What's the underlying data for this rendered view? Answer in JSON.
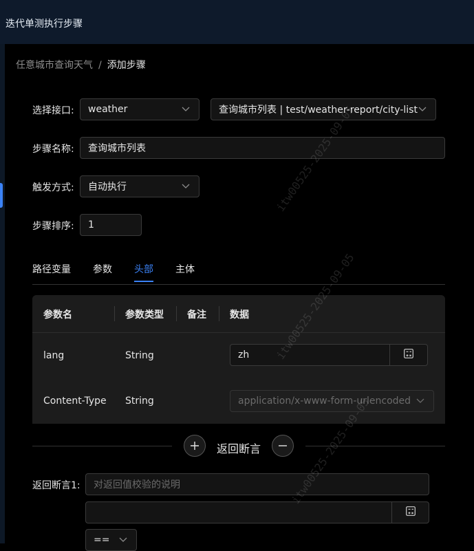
{
  "window": {
    "title": "迭代单测执行步骤"
  },
  "breadcrumb": {
    "parent": "任意城市查询天气",
    "separator": "/",
    "current": "添加步骤"
  },
  "form": {
    "interface_label": "选择接口:",
    "interface_group": "weather",
    "interface_api": "查询城市列表 | test/weather-report/city-list",
    "step_name_label": "步骤名称:",
    "step_name_value": "查询城市列表",
    "trigger_label": "触发方式:",
    "trigger_value": "自动执行",
    "order_label": "步骤排序:",
    "order_value": "1"
  },
  "tabs": [
    "路径变量",
    "参数",
    "头部",
    "主体"
  ],
  "active_tab": "头部",
  "table": {
    "headers": [
      "参数名",
      "参数类型",
      "备注",
      "数据"
    ],
    "rows": [
      {
        "name": "lang",
        "type": "String",
        "note": "",
        "data": "zh",
        "editable": true
      },
      {
        "name": "Content-Type",
        "type": "String",
        "note": "",
        "data": "application/x-www-form-urlencoded",
        "editable": false
      }
    ]
  },
  "assertions": {
    "title": "返回断言",
    "item_label": "返回断言1:",
    "description_placeholder": "对返回值校验的说明",
    "expression_value": "",
    "operator": "=="
  },
  "watermark": "itw00525-2025-09-05",
  "colors": {
    "accent": "#3b82f6",
    "topbar": "#0e1a2b",
    "panel": "#000000",
    "table": "#1c1c1c"
  }
}
